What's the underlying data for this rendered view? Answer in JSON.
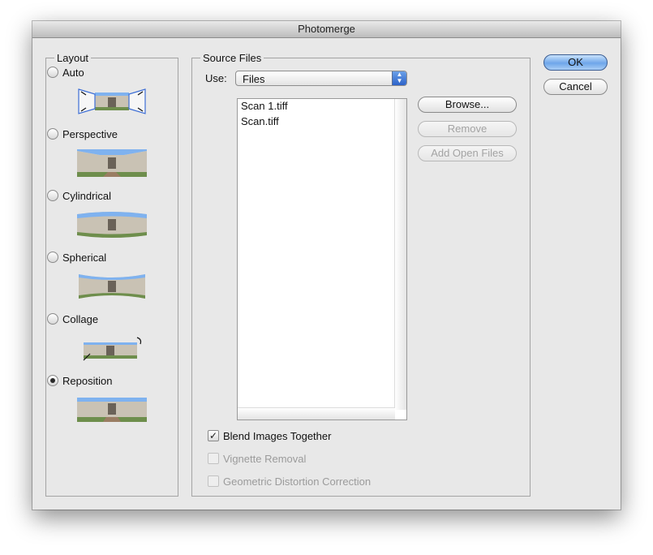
{
  "window": {
    "title": "Photomerge"
  },
  "layout": {
    "legend": "Layout",
    "options": [
      {
        "label": "Auto",
        "selected": false
      },
      {
        "label": "Perspective",
        "selected": false
      },
      {
        "label": "Cylindrical",
        "selected": false
      },
      {
        "label": "Spherical",
        "selected": false
      },
      {
        "label": "Collage",
        "selected": false
      },
      {
        "label": "Reposition",
        "selected": true
      }
    ]
  },
  "source": {
    "legend": "Source Files",
    "use_label": "Use:",
    "use_value": "Files",
    "files": [
      "Scan 1.tiff",
      "Scan.tiff"
    ],
    "browse_label": "Browse...",
    "remove_label": "Remove",
    "add_open_label": "Add Open Files"
  },
  "options": {
    "blend": {
      "label": "Blend Images Together",
      "checked": true,
      "enabled": true
    },
    "vignette": {
      "label": "Vignette Removal",
      "checked": false,
      "enabled": false
    },
    "geometric": {
      "label": "Geometric Distortion Correction",
      "checked": false,
      "enabled": false
    }
  },
  "buttons": {
    "ok_label": "OK",
    "cancel_label": "Cancel"
  },
  "icons": {
    "radio_dot": "radio-checked",
    "checkmark": "✓",
    "select_arrows": "▲▼"
  },
  "colors": {
    "accent": "#3e7ce0",
    "sky": "#7fb2ef",
    "building": "#c9c2b4",
    "grass": "#6e8e4c",
    "path": "#9a7d63"
  }
}
